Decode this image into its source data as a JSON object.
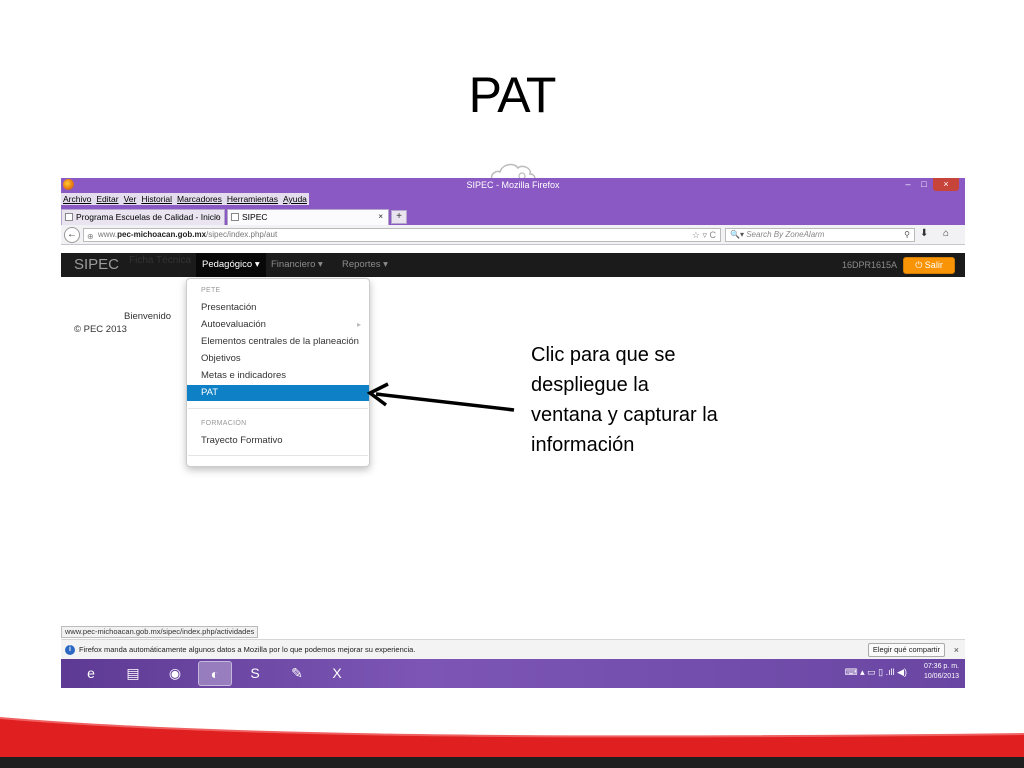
{
  "slide": {
    "title": "PAT",
    "callout": "Clic para que se despliegue la ventana y capturar la información"
  },
  "browser": {
    "window_title": "SIPEC - Mozilla Firefox",
    "window_controls": {
      "minimize": "–",
      "maximize": "□",
      "close": "×"
    },
    "menu": [
      "Archivo",
      "Editar",
      "Ver",
      "Historial",
      "Marcadores",
      "Herramientas",
      "Ayuda"
    ],
    "tabs": [
      {
        "label": "Programa Escuelas de Calidad - Inicio",
        "close": "×"
      },
      {
        "label": "SIPEC",
        "close": "×"
      }
    ],
    "new_tab": "+",
    "back": "←",
    "url_prefix": "www.",
    "url_domain": "pec-michoacan.gob.mx",
    "url_path": "/sipec/index.php/aut",
    "url_icons": "☆ ▿ C",
    "search_placeholder": "Search By ZoneAlarm",
    "search_engine_icon": "🔍▾",
    "search_icon": "⚲",
    "download_icon": "⬇",
    "home_icon": "⌂",
    "status_url": "www.pec-michoacan.gob.mx/sipec/index.php/actividades",
    "notification": "Firefox manda automáticamente algunos datos a Mozilla por lo que podemos mejorar su experiencia.",
    "notification_icon": "i",
    "share_button": "Elegir qué compartir",
    "notification_close": "×"
  },
  "app": {
    "brand": "SIPEC",
    "brand_ghost": "Ficha Técnica",
    "nav": [
      {
        "label": "Pedagógico ▾",
        "active": true
      },
      {
        "label": "Financiero ▾",
        "active": false
      },
      {
        "label": "Reportes ▾",
        "active": false
      }
    ],
    "school_code": "16DPR1615A",
    "logout_button": "⏻ Salir",
    "welcome": "Bienvenido",
    "copyright": "© PEC 2013"
  },
  "dropdown": {
    "section1": "PETE",
    "items1": [
      "Presentación",
      "Autoevaluación",
      "Elementos centrales de la planeación",
      "Objetivos",
      "Metas e indicadores",
      "PAT"
    ],
    "submenu_caret": "▸",
    "active_item": "PAT",
    "section2": "FORMACIÓN",
    "items2": [
      "Trayecto Formativo"
    ]
  },
  "taskbar": {
    "apps": [
      {
        "icon": "ie-icon",
        "glyph": "e"
      },
      {
        "icon": "folder-icon",
        "glyph": "▤"
      },
      {
        "icon": "chrome-icon",
        "glyph": "◉"
      },
      {
        "icon": "firefox-icon",
        "glyph": "◐"
      },
      {
        "icon": "skype-icon",
        "glyph": "S"
      },
      {
        "icon": "paint-icon",
        "glyph": "✎"
      },
      {
        "icon": "excel-icon",
        "glyph": "X"
      }
    ],
    "tray": "⌨ ▴ ▭ ▯ .ıll ◀)",
    "time": "07:36 p. m.",
    "date": "10/06/2013"
  },
  "colors": {
    "firefox_purple": "#8a59c4",
    "navbar_dark": "#1b1b1b",
    "dropdown_active": "#0e80c6",
    "salir_orange": "#f89406",
    "footer_red": "#e02020"
  }
}
